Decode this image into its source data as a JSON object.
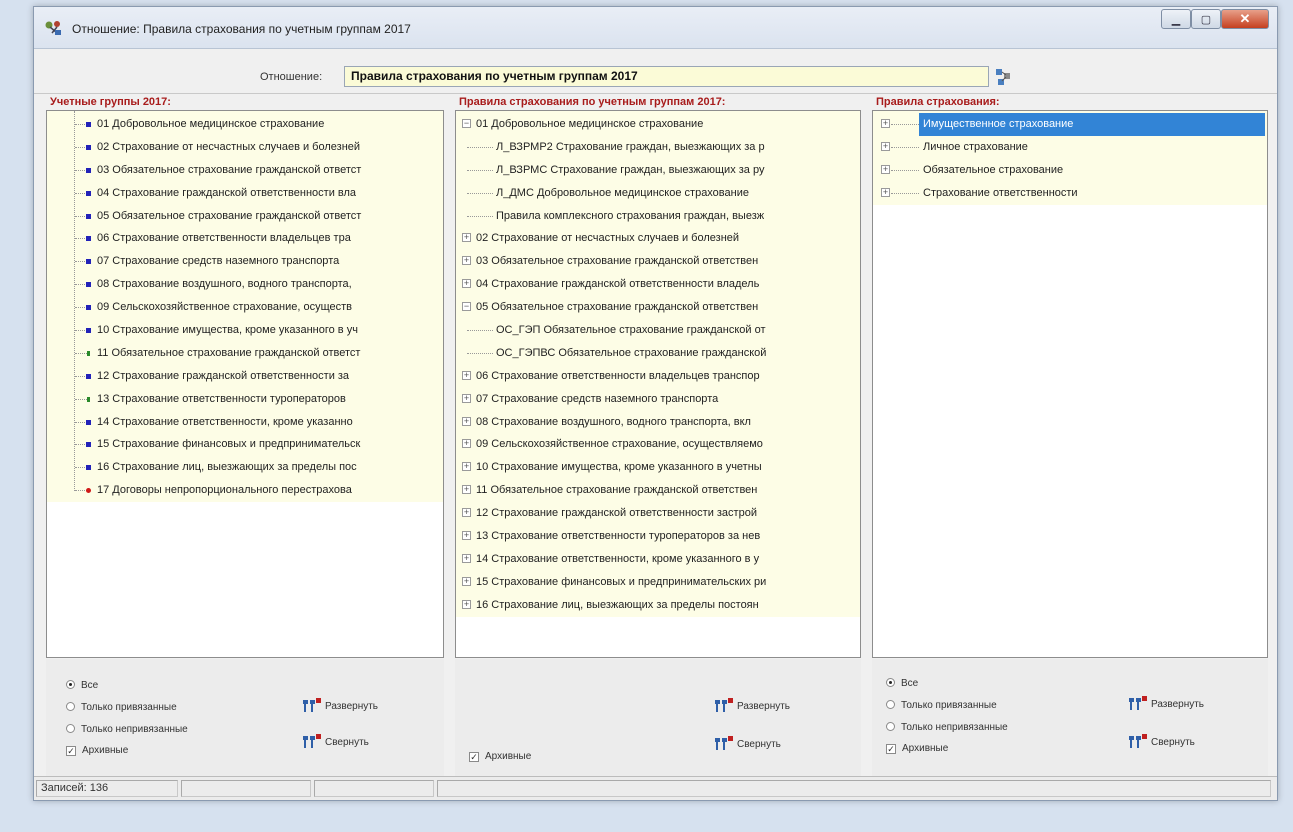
{
  "window": {
    "title": "Отношение: Правила страхования по учетным группам 2017",
    "relation_label": "Отношение:",
    "relation_value": "Правила страхования по учетным группам 2017"
  },
  "panels": {
    "left": {
      "title": "Учетные группы 2017:",
      "items": [
        {
          "label": "01 Добровольное медицинское страхование",
          "marker": "blue"
        },
        {
          "label": "02 Страхование от несчастных случаев и болезней",
          "marker": "blue"
        },
        {
          "label": "03 Обязательное страхование гражданской ответст",
          "marker": "blue"
        },
        {
          "label": "04 Страхование гражданской ответственности вла",
          "marker": "blue"
        },
        {
          "label": "05 Обязательное страхование гражданской ответст",
          "marker": "blue"
        },
        {
          "label": "06 Страхование ответственности владельцев тра",
          "marker": "blue"
        },
        {
          "label": "07 Страхование средств наземного транспорта",
          "marker": "blue"
        },
        {
          "label": "08 Страхование воздушного, водного транспорта,",
          "marker": "blue"
        },
        {
          "label": "09 Сельскохозяйственное страхование, осуществ",
          "marker": "blue"
        },
        {
          "label": "10 Страхование имущества, кроме указанного в уч",
          "marker": "blue"
        },
        {
          "label": "11 Обязательное страхование гражданской ответст",
          "marker": "green"
        },
        {
          "label": "12 Страхование гражданской ответственности за",
          "marker": "blue"
        },
        {
          "label": "13 Страхование ответственности туроператоров",
          "marker": "green"
        },
        {
          "label": "14 Страхование ответственности, кроме указанно",
          "marker": "blue"
        },
        {
          "label": "15 Страхование финансовых и предпринимательск",
          "marker": "blue"
        },
        {
          "label": "16 Страхование лиц, выезжающих за пределы пос",
          "marker": "blue"
        },
        {
          "label": "17 Договоры непропорционального перестрахова",
          "marker": "red"
        }
      ],
      "radios": [
        "Все",
        "Только привязанные",
        "Только непривязанные"
      ],
      "radio_selected": 0,
      "archive_label": "Архивные",
      "archive_checked": true,
      "expand_label": "Развернуть",
      "collapse_label": "Свернуть"
    },
    "middle": {
      "title": "Правила страхования по учетным группам 2017:",
      "items": [
        {
          "label": "01 Добровольное медицинское страхование",
          "level": 0,
          "expander": "minus"
        },
        {
          "label": "Л_ВЗРМР2 Страхование граждан, выезжающих за р",
          "level": 1,
          "expander": ""
        },
        {
          "label": "Л_ВЗРМС Страхование граждан, выезжающих за ру",
          "level": 1,
          "expander": ""
        },
        {
          "label": "Л_ДМС Добровольное медицинское страхование",
          "level": 1,
          "expander": ""
        },
        {
          "label": "Правила комплексного страхования граждан, выезж",
          "level": 1,
          "expander": ""
        },
        {
          "label": "02 Страхование от несчастных случаев и болезней",
          "level": 0,
          "expander": "plus"
        },
        {
          "label": "03 Обязательное страхование гражданской ответствен",
          "level": 0,
          "expander": "plus"
        },
        {
          "label": "04 Страхование гражданской ответственности владель",
          "level": 0,
          "expander": "plus"
        },
        {
          "label": "05 Обязательное страхование гражданской ответствен",
          "level": 0,
          "expander": "minus"
        },
        {
          "label": "ОС_ГЭП Обязательное страхование гражданской от",
          "level": 1,
          "expander": ""
        },
        {
          "label": "ОС_ГЭПВС Обязательное страхование гражданской",
          "level": 1,
          "expander": ""
        },
        {
          "label": "06 Страхование ответственности владельцев транспор",
          "level": 0,
          "expander": "plus"
        },
        {
          "label": "07 Страхование средств наземного транспорта",
          "level": 0,
          "expander": "plus"
        },
        {
          "label": "08 Страхование воздушного, водного транспорта, вкл",
          "level": 0,
          "expander": "plus"
        },
        {
          "label": "09 Сельскохозяйственное страхование, осуществляемо",
          "level": 0,
          "expander": "plus"
        },
        {
          "label": "10 Страхование имущества, кроме указанного в учетны",
          "level": 0,
          "expander": "plus"
        },
        {
          "label": "11 Обязательное страхование гражданской ответствен",
          "level": 0,
          "expander": "plus"
        },
        {
          "label": "12 Страхование гражданской ответственности застрой",
          "level": 0,
          "expander": "plus"
        },
        {
          "label": "13 Страхование ответственности туроператоров за нев",
          "level": 0,
          "expander": "plus"
        },
        {
          "label": "14 Страхование ответственности, кроме указанного в у",
          "level": 0,
          "expander": "plus"
        },
        {
          "label": "15 Страхование финансовых и предпринимательских ри",
          "level": 0,
          "expander": "plus"
        },
        {
          "label": "16 Страхование лиц, выезжающих за пределы постоян",
          "level": 0,
          "expander": "plus"
        }
      ],
      "archive_label": "Архивные",
      "archive_checked": true,
      "expand_label": "Развернуть",
      "collapse_label": "Свернуть"
    },
    "right": {
      "title": "Правила страхования:",
      "items": [
        {
          "label": "Имущественное страхование",
          "selected": true
        },
        {
          "label": "Личное страхование",
          "selected": false
        },
        {
          "label": "Обязательное страхование",
          "selected": false
        },
        {
          "label": "Страхование ответственности",
          "selected": false
        }
      ],
      "radios": [
        "Все",
        "Только привязанные",
        "Только непривязанные"
      ],
      "radio_selected": 0,
      "archive_label": "Архивные",
      "archive_checked": true,
      "expand_label": "Развернуть",
      "collapse_label": "Свернуть"
    }
  },
  "status": {
    "records": "Записей: 136"
  },
  "colors": {
    "panel_title": "#a81c1c",
    "tree_bg": "#fdfde6",
    "selection": "#3284d6"
  }
}
